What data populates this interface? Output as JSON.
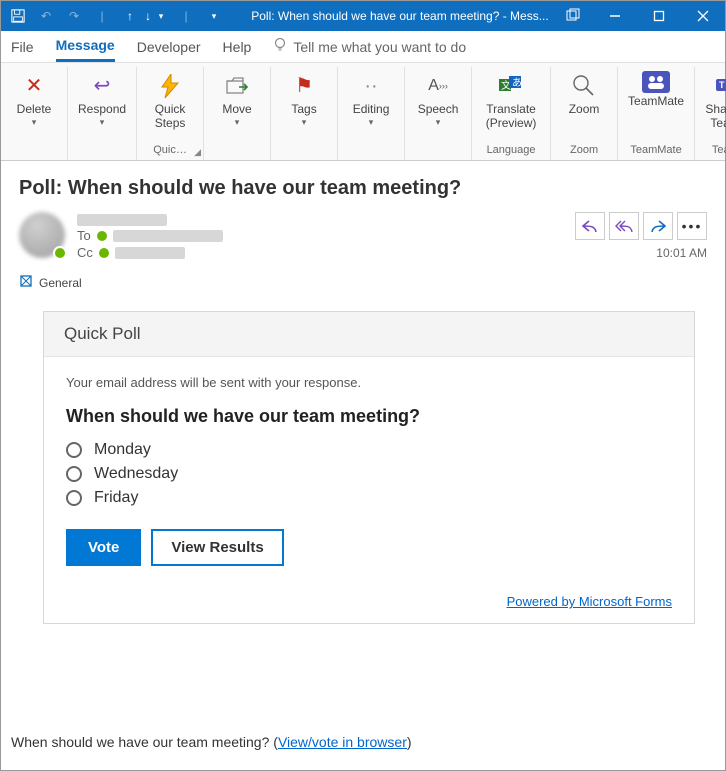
{
  "window": {
    "title": "Poll: When should we have our team meeting?  -  Mess..."
  },
  "menu": {
    "file": "File",
    "message": "Message",
    "developer": "Developer",
    "help": "Help",
    "tellme": "Tell me what you want to do"
  },
  "ribbon": {
    "delete": "Delete",
    "respond": "Respond",
    "quicksteps": "Quick\nSteps",
    "quicksteps_group": "Quic…",
    "move": "Move",
    "tags": "Tags",
    "editing": "Editing",
    "speech": "Speech",
    "translate": "Translate\n(Preview)",
    "language_group": "Language",
    "zoom": "Zoom",
    "zoom_group": "Zoom",
    "teammate": "TeamMate",
    "teammate_group": "TeamMate",
    "shareteams": "Share to\nTeams",
    "teams_group": "Teams"
  },
  "header": {
    "subject": "Poll: When should we have our team meeting?",
    "to_label": "To",
    "cc_label": "Cc",
    "timestamp": "10:01 AM",
    "category": "General"
  },
  "poll": {
    "card_title": "Quick Poll",
    "note": "Your email address will be sent with your response.",
    "question": "When should we have our team meeting?",
    "options": [
      "Monday",
      "Wednesday",
      "Friday"
    ],
    "vote_label": "Vote",
    "results_label": "View Results",
    "forms_link": "Powered by Microsoft Forms"
  },
  "footer": {
    "text": "When should we have our team meeting? (",
    "link": "View/vote in browser",
    "closeparen": ")"
  }
}
